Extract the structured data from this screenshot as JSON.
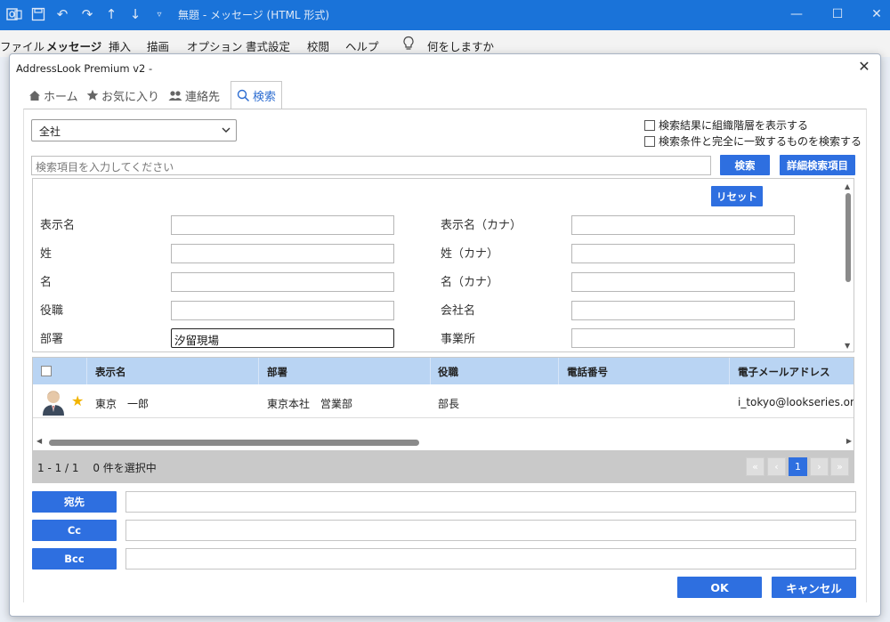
{
  "window": {
    "title": "無題 - メッセージ (HTML 形式)"
  },
  "ribbon": {
    "tabs": [
      "ファイル",
      "メッセージ",
      "挿入",
      "描画",
      "オプション",
      "書式設定",
      "校閲",
      "ヘルプ"
    ],
    "active_tab": "メッセージ",
    "tell_me": "何をしますか"
  },
  "dialog": {
    "title": "AddressLook Premium v2 -",
    "tabs": [
      {
        "label": "ホーム",
        "icon": "home-icon"
      },
      {
        "label": "お気に入り",
        "icon": "star-icon"
      },
      {
        "label": "連絡先",
        "icon": "contacts-icon"
      },
      {
        "label": "検索",
        "icon": "search-icon"
      }
    ],
    "active_tab": "検索",
    "scope_select": "全社",
    "options": {
      "show_hierarchy": "検索結果に組織階層を表示する",
      "exact_match": "検索条件と完全に一致するものを検索する"
    },
    "search": {
      "placeholder": "検索項目を入力してください",
      "search_button": "検索",
      "advanced_button": "詳細検索項目"
    },
    "reset_button": "リセット",
    "fields": {
      "display_name": {
        "label": "表示名",
        "value": ""
      },
      "display_name_kana": {
        "label": "表示名（カナ）",
        "value": ""
      },
      "last_name": {
        "label": "姓",
        "value": ""
      },
      "last_name_kana": {
        "label": "姓（カナ）",
        "value": ""
      },
      "first_name": {
        "label": "名",
        "value": ""
      },
      "first_name_kana": {
        "label": "名（カナ）",
        "value": ""
      },
      "title": {
        "label": "役職",
        "value": ""
      },
      "company": {
        "label": "会社名",
        "value": ""
      },
      "department": {
        "label": "部署",
        "value": "汐留現場"
      },
      "office": {
        "label": "事業所",
        "value": ""
      }
    },
    "table": {
      "columns": [
        "表示名",
        "部署",
        "役職",
        "電話番号",
        "電子メールアドレス"
      ],
      "rows": [
        {
          "name": "東京　一郎",
          "department": "東京本社　営業部",
          "title": "部長",
          "phone": "",
          "email": "i_tokyo@lookseries.onmic",
          "favorite": true
        }
      ]
    },
    "footer": {
      "count": "1 - 1 / 1　  0 件を選択中",
      "current_page": "1"
    },
    "recipients": {
      "to": "宛先",
      "cc": "Cc",
      "bcc": "Bcc"
    },
    "ok_button": "OK",
    "cancel_button": "キャンセル"
  },
  "colors": {
    "titlebar": "#1a73d9",
    "accent": "#2e6fe0",
    "table_header": "#b9d4f3"
  }
}
